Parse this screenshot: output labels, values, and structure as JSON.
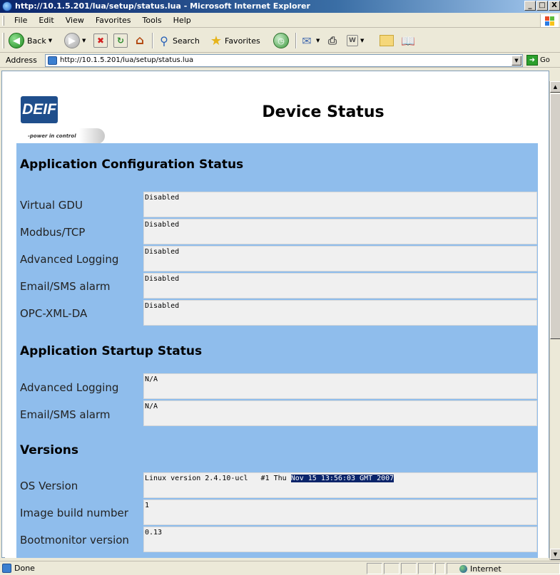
{
  "window": {
    "title": "http://10.1.5.201/lua/setup/status.lua - Microsoft Internet Explorer",
    "controls": {
      "minimize": "_",
      "maximize": "□",
      "close": "X"
    }
  },
  "menu": [
    "File",
    "Edit",
    "View",
    "Favorites",
    "Tools",
    "Help"
  ],
  "toolbar": {
    "back_label": "Back",
    "search_label": "Search",
    "favorites_label": "Favorites",
    "icons": [
      "back-icon",
      "forward-icon",
      "stop-icon",
      "refresh-icon",
      "home-icon",
      "search-icon",
      "favorites-icon",
      "history-icon",
      "mail-icon",
      "print-icon",
      "edit-icon",
      "discuss-icon",
      "research-icon"
    ]
  },
  "address": {
    "label": "Address",
    "url": "http://10.1.5.201/lua/setup/status.lua",
    "go_label": "Go"
  },
  "page": {
    "logo_text": "DEIF",
    "logo_tagline": "-power in control",
    "title": "Device Status",
    "sections": [
      {
        "title": "Application Configuration Status",
        "rows": [
          {
            "label": "Virtual GDU",
            "value": "Disabled"
          },
          {
            "label": "Modbus/TCP",
            "value": "Disabled"
          },
          {
            "label": "Advanced Logging",
            "value": "Disabled"
          },
          {
            "label": "Email/SMS alarm",
            "value": "Disabled"
          },
          {
            "label": "OPC-XML-DA",
            "value": "Disabled"
          }
        ]
      },
      {
        "title": "Application Startup Status",
        "rows": [
          {
            "label": "Advanced Logging",
            "value": "N/A"
          },
          {
            "label": "Email/SMS alarm",
            "value": "N/A"
          }
        ]
      },
      {
        "title": "Versions",
        "rows": [
          {
            "label": "OS Version",
            "value_plain": "Linux version 2.4.10-ucl   #1 Thu ",
            "value_selected": "Nov 15 13:56:03 GMT 2007"
          },
          {
            "label": "Image build number",
            "value": "1"
          },
          {
            "label": "Bootmonitor version",
            "value": "0.13"
          }
        ]
      }
    ]
  },
  "status": {
    "text": "Done",
    "zone": "Internet"
  },
  "colors": {
    "panel_bg": "#8fbdec",
    "value_bg": "#f0f0f0",
    "selection_bg": "#0a246a",
    "logo_blue": "#1f4e8c"
  }
}
